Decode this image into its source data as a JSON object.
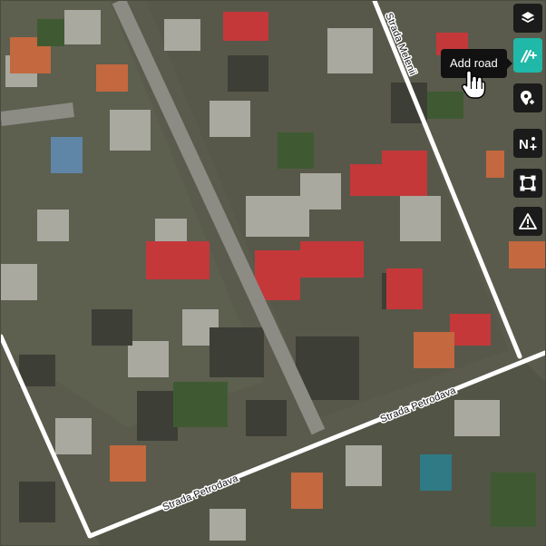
{
  "map": {
    "streets": [
      {
        "name": "Strada Melenii"
      },
      {
        "name": "Strada Petrodava"
      },
      {
        "name": "Strada Petrodava"
      }
    ]
  },
  "toolbar": {
    "tools": [
      {
        "icon": "layers-icon",
        "active": false
      },
      {
        "icon": "add-road-icon",
        "active": true
      },
      {
        "icon": "add-place-icon",
        "active": false
      },
      {
        "icon": "add-node-icon",
        "active": false
      },
      {
        "icon": "draw-area-icon",
        "active": false
      },
      {
        "icon": "warning-icon",
        "active": false
      }
    ],
    "tooltip": "Add road"
  },
  "colors": {
    "toolbar_bg": "#1b1b1b",
    "active_tool": "#20b8a8",
    "road_line": "#ffffff"
  }
}
